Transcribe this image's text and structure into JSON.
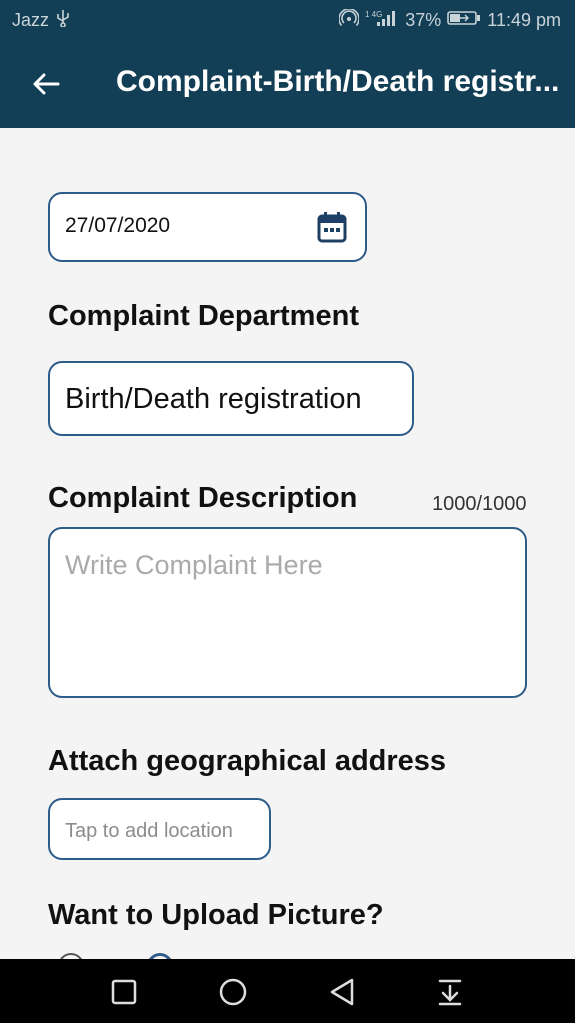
{
  "status_bar": {
    "carrier": "Jazz",
    "battery": "37%",
    "time": "11:49 pm"
  },
  "app_bar": {
    "title": "Complaint-Birth/Death registr..."
  },
  "form": {
    "date_value": "27/07/2020",
    "department_label": "Complaint Department",
    "department_value": "Birth/Death registration",
    "description_label": "Complaint Description",
    "description_counter": "1000/1000",
    "description_placeholder": "Write Complaint Here",
    "address_label": "Attach geographical address",
    "location_button": "Tap to add location",
    "upload_label": "Want to Upload Picture?"
  },
  "colors": {
    "app_bar": "#123f55",
    "field_border": "#2d5b8a",
    "nav_bar": "#000000"
  }
}
